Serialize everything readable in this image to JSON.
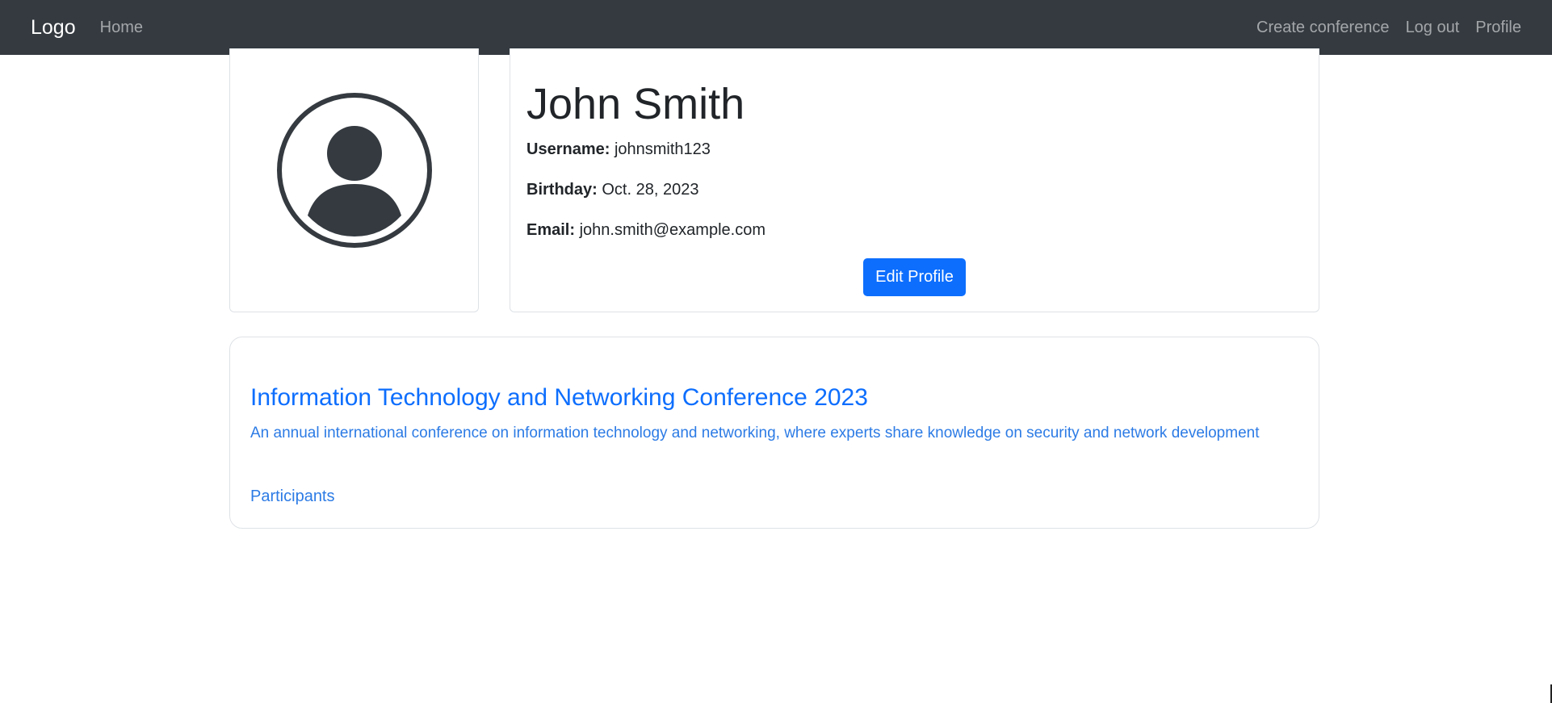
{
  "navbar": {
    "brand": "Logo",
    "home": "Home",
    "right_items": [
      "Create conference",
      "Log out",
      "Profile"
    ]
  },
  "profile": {
    "name": "John Smith",
    "username_label": "Username:",
    "username": "johnsmith123",
    "birthday_label": "Birthday:",
    "birthday": "Oct. 28, 2023",
    "email_label": "Email:",
    "email": "john.smith@example.com",
    "edit_button": "Edit Profile",
    "avatar_icon": "person-circle-icon"
  },
  "conference": {
    "title": "Information Technology and Networking Conference 2023",
    "description": "An annual international conference on information technology and networking, where experts share knowledge on security and network development",
    "participants_link": "Participants"
  },
  "colors": {
    "navbar_bg": "#343a40",
    "primary": "#0d6efd",
    "link": "#2c7be5",
    "avatar": "#343a40"
  }
}
